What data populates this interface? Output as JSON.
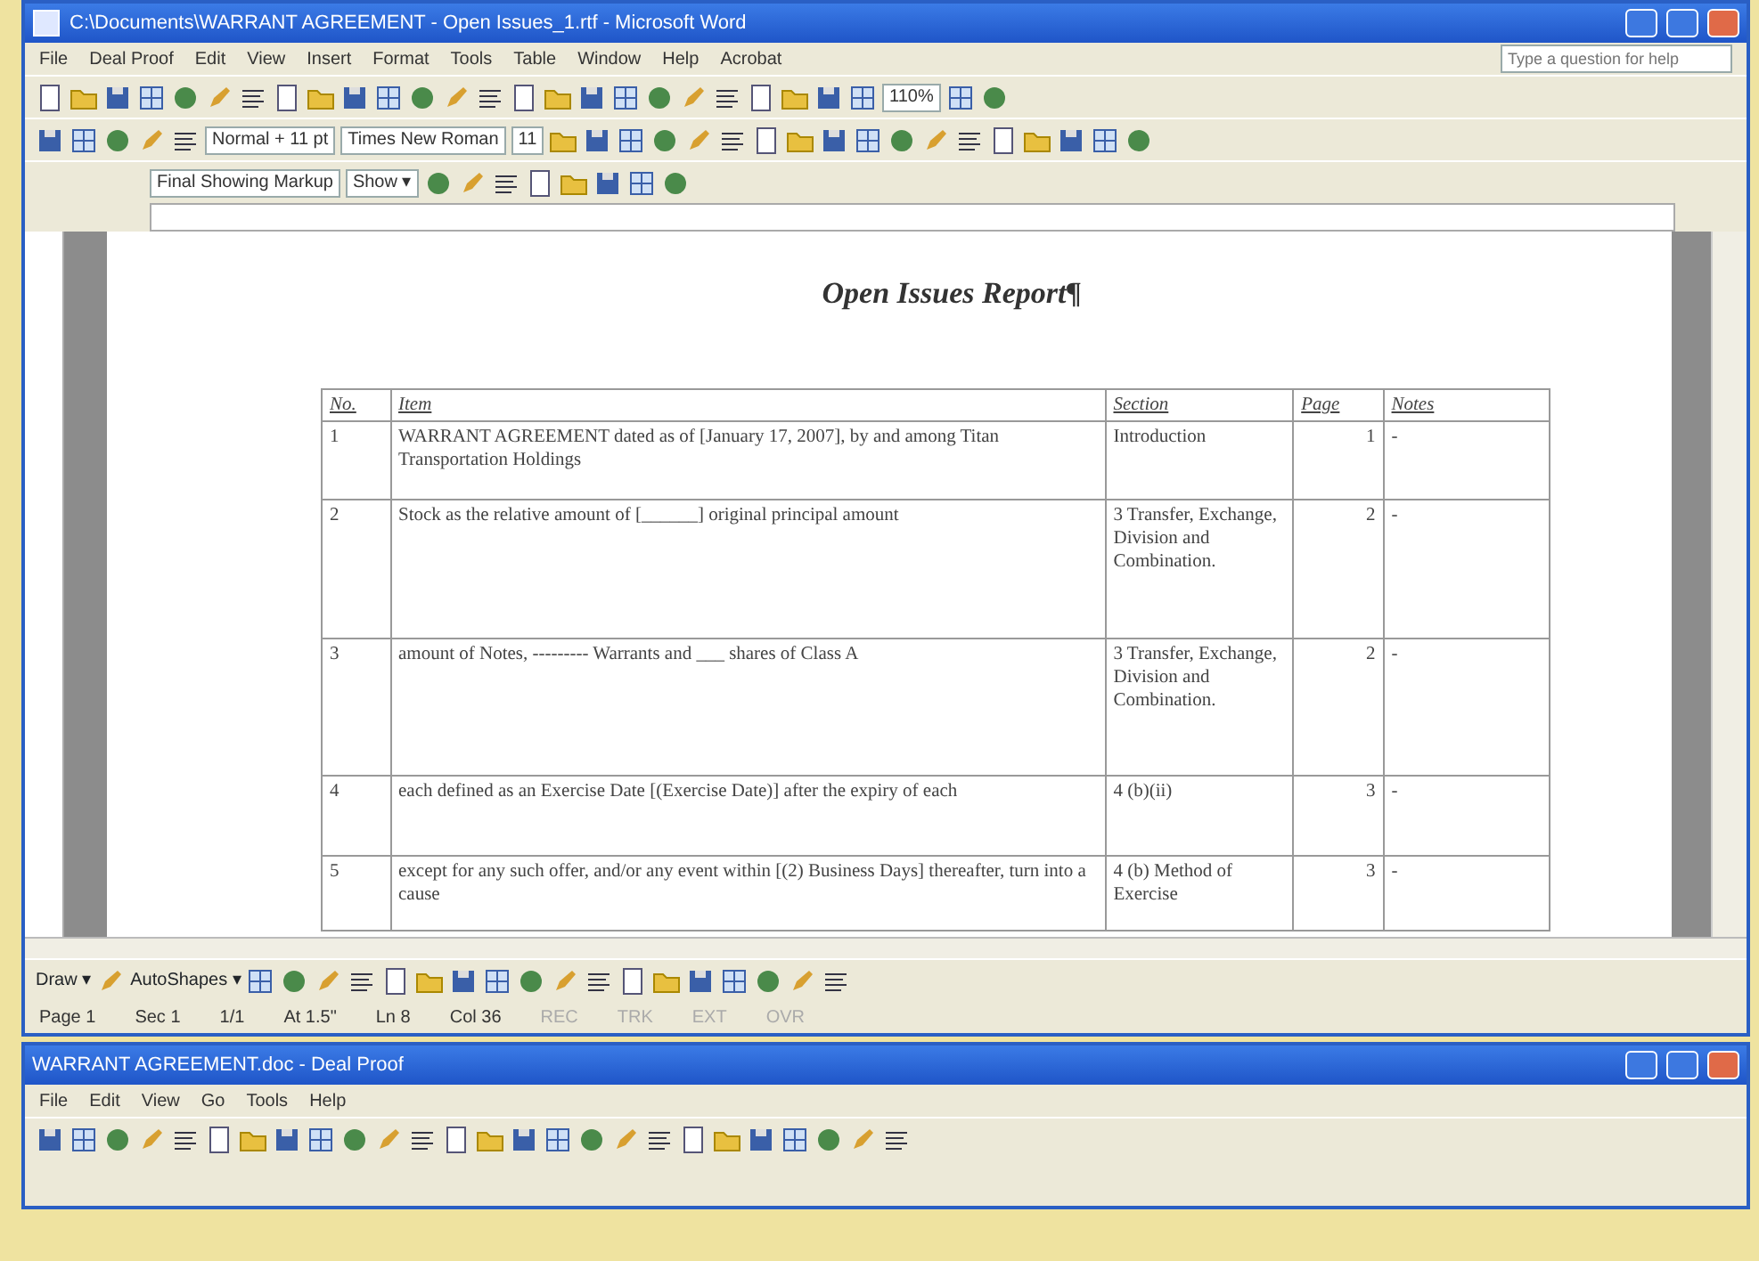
{
  "window": {
    "title": "C:\\Documents\\WARRANT AGREEMENT - Open Issues_1.rtf - Microsoft Word"
  },
  "menu": [
    "File",
    "Deal Proof",
    "Edit",
    "View",
    "Insert",
    "Format",
    "Tools",
    "Table",
    "Window",
    "Help",
    "Acrobat"
  ],
  "help_box": {
    "placeholder": "Type a question for help"
  },
  "toolbars": {
    "zoom": "110%",
    "style": "Normal + 11 pt",
    "font": "Times New Roman",
    "size": "11",
    "markup": "Final Showing Markup",
    "show": "Show ▾"
  },
  "document": {
    "title": "Open Issues Report¶",
    "columns": [
      "No.",
      "Item",
      "Section",
      "Page",
      "Notes"
    ],
    "rows": [
      {
        "no": "1",
        "item": "WARRANT AGREEMENT dated as of [January 17, 2007], by and among Titan Transportation Holdings",
        "section": "Introduction",
        "page": "1",
        "notes": "-"
      },
      {
        "no": "2",
        "item": "Stock as the relative amount of [______] original principal amount",
        "section": "3 Transfer, Exchange, Division and Combination.",
        "page": "2",
        "notes": "-"
      },
      {
        "no": "3",
        "item": "amount of Notes, --------- Warrants and ___ shares of Class A",
        "section": "3 Transfer, Exchange, Division and Combination.",
        "page": "2",
        "notes": "-"
      },
      {
        "no": "4",
        "item": "each defined as an Exercise Date [(Exercise Date)] after the expiry of each",
        "section": "4 (b)(ii)",
        "page": "3",
        "notes": "-"
      },
      {
        "no": "5",
        "item": "except for any such offer, and/or any event within [(2) Business Days] thereafter, turn into a cause",
        "section": "4 (b) Method of Exercise",
        "page": "3",
        "notes": "-"
      }
    ]
  },
  "drawing_toolbar": [
    "Draw ▾",
    "AutoShapes ▾"
  ],
  "status_bar": [
    {
      "text": "Page 1",
      "disabled": false
    },
    {
      "text": "Sec 1",
      "disabled": false
    },
    {
      "text": "1/1",
      "disabled": false
    },
    {
      "text": "At 1.5\"",
      "disabled": false
    },
    {
      "text": "Ln 8",
      "disabled": false
    },
    {
      "text": "Col 36",
      "disabled": false
    },
    {
      "text": "REC",
      "disabled": true
    },
    {
      "text": "TRK",
      "disabled": true
    },
    {
      "text": "EXT",
      "disabled": true
    },
    {
      "text": "OVR",
      "disabled": true
    }
  ],
  "second_window": {
    "title": "WARRANT AGREEMENT.doc - Deal Proof",
    "menu": [
      "File",
      "Edit",
      "View",
      "Go",
      "Tools",
      "Help"
    ]
  }
}
